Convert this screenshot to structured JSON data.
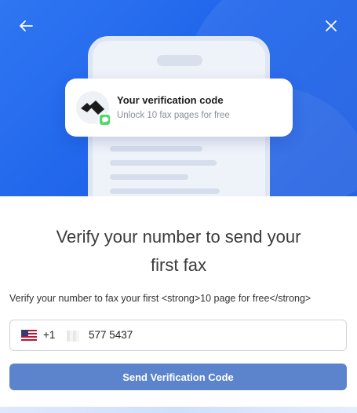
{
  "dialog": {
    "back_icon": "arrow-left-icon",
    "close_icon": "close-icon"
  },
  "notification": {
    "title": "Your verification code",
    "subtitle": "Unlock 10 fax pages for free",
    "badge_icon": "message-bubble-icon",
    "logo_icon": "app-logo-icon"
  },
  "main": {
    "heading_line1": "Verify your number to send your",
    "heading_line2": "first fax",
    "subtext": "Verify your number to fax your first <strong>10 page for free</strong>"
  },
  "phone_input": {
    "flag_icon": "us-flag-icon",
    "country_code": "+1",
    "value": "577 5437"
  },
  "actions": {
    "send_label": "Send Verification Code"
  },
  "colors": {
    "hero_blue": "#1e63ea",
    "button_blue": "#5b84cc",
    "badge_green": "#4cd964"
  }
}
